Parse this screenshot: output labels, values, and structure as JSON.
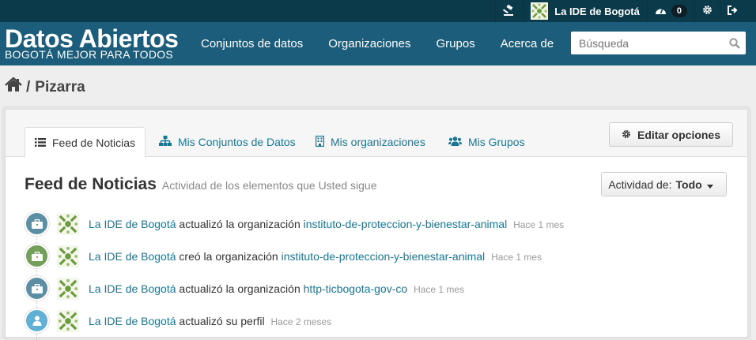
{
  "topbar": {
    "org_name": "La IDE de Bogotá",
    "dashboard_count": "0"
  },
  "header": {
    "brand_title": "Datos Abiertos",
    "brand_subtitle": "BOGOTÁ MEJOR PARA TODOS",
    "nav": [
      {
        "label": "Conjuntos de datos"
      },
      {
        "label": "Organizaciones"
      },
      {
        "label": "Grupos"
      },
      {
        "label": "Acerca de"
      }
    ],
    "search_placeholder": "Búsqueda"
  },
  "breadcrumb": {
    "separator": "/",
    "current": "Pizarra"
  },
  "tabs": [
    {
      "label": "Feed de Noticias",
      "icon": "list-icon"
    },
    {
      "label": "Mis Conjuntos de Datos",
      "icon": "sitemap-icon"
    },
    {
      "label": "Mis organizaciones",
      "icon": "building-icon"
    },
    {
      "label": "Mis Grupos",
      "icon": "group-icon"
    }
  ],
  "edit_button": "Editar opciones",
  "feed": {
    "title": "Feed de Noticias",
    "subtitle": "Actividad de los elementos que Usted sigue",
    "filter_label": "Actividad de:",
    "filter_value": "Todo"
  },
  "colors": {
    "topbar": "#0b3a4a",
    "header": "#1b5d7b",
    "link": "#187794",
    "org_update": "#5c8fa3",
    "org_create": "#72a05a",
    "user_update": "#5fb0d4"
  },
  "activities": [
    {
      "actor": "La IDE de Bogotá",
      "action": "actualizó la organización",
      "object": "instituto-de-proteccion-y-bienestar-animal",
      "time": "Hace 1 mes",
      "icon": "briefcase-icon"
    },
    {
      "actor": "La IDE de Bogotá",
      "action": "creó la organización",
      "object": "instituto-de-proteccion-y-bienestar-animal",
      "time": "Hace 1 mes",
      "icon": "briefcase-icon"
    },
    {
      "actor": "La IDE de Bogotá",
      "action": "actualizó la organización",
      "object": "http-ticbogota-gov-co",
      "time": "Hace 1 mes",
      "icon": "briefcase-icon"
    },
    {
      "actor": "La IDE de Bogotá",
      "action": "actualizó su perfil",
      "object": "",
      "time": "Hace 2 meses",
      "icon": "user-icon"
    }
  ]
}
